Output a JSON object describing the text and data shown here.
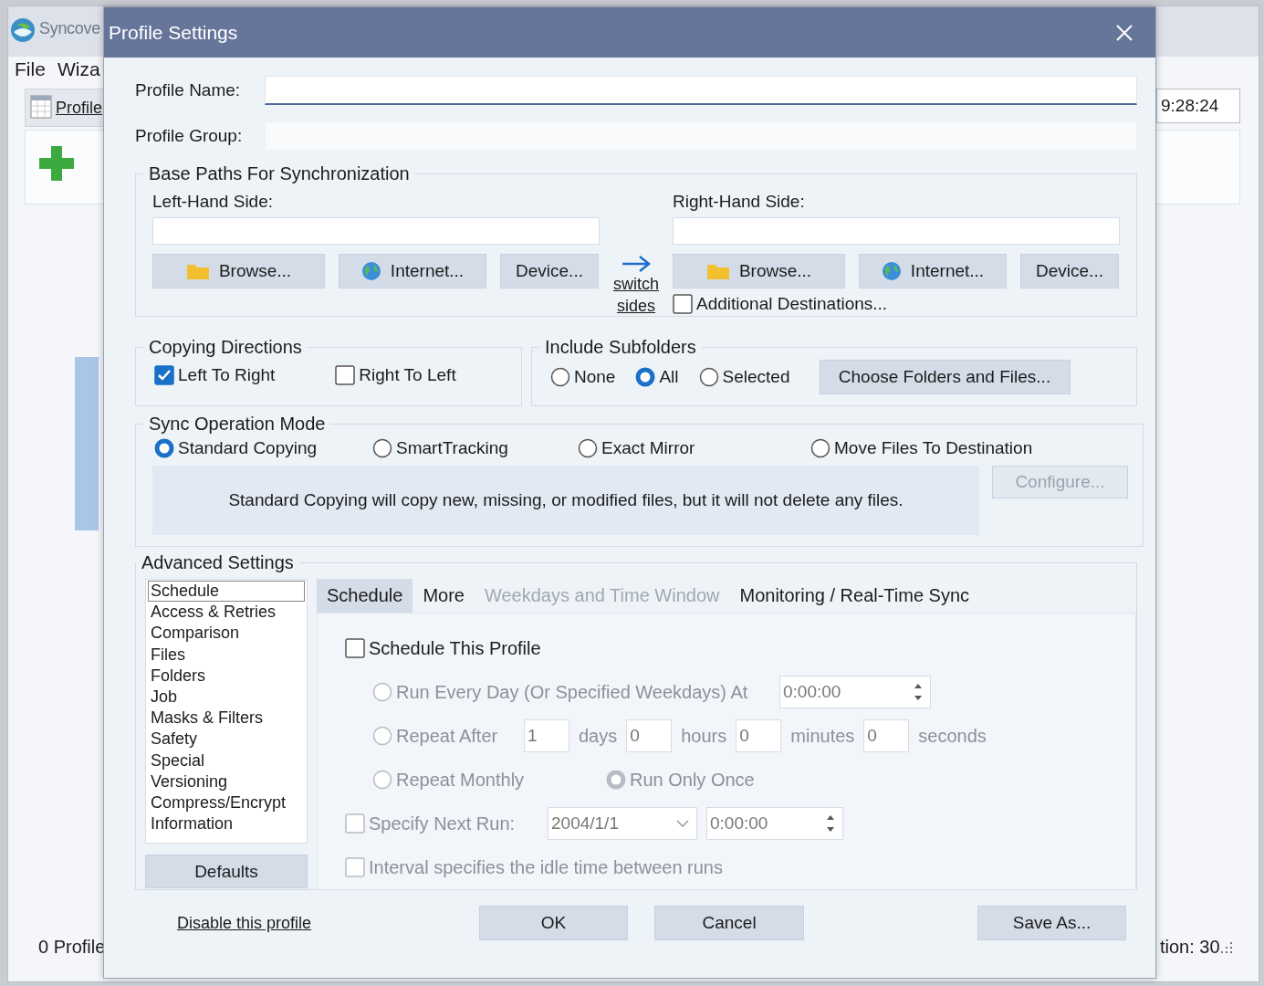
{
  "background_window": {
    "title": "Syncove",
    "menu": [
      "File",
      "Wiza"
    ],
    "tab": "Profile",
    "time": "9:28:24",
    "status_left": "0 Profile",
    "status_right": "tion: 30"
  },
  "dialog": {
    "title": "Profile Settings",
    "fields": [
      {
        "label": "Profile Name:",
        "focused": true
      },
      {
        "label": "Profile Group:",
        "focused": false
      }
    ],
    "base_paths": {
      "title": "Base Paths For Synchronization",
      "left": {
        "label": "Left-Hand Side:",
        "buttons": [
          {
            "label": "Browse...",
            "kind": "folder"
          },
          {
            "label": "Internet...",
            "kind": "globe"
          },
          {
            "label": "Device...",
            "kind": "plain"
          }
        ]
      },
      "switch": "switch sides",
      "right": {
        "label": "Right-Hand Side:",
        "buttons": [
          {
            "label": "Browse...",
            "kind": "folder"
          },
          {
            "label": "Internet...",
            "kind": "globe"
          },
          {
            "label": "Device...",
            "kind": "plain"
          }
        ]
      },
      "additional": {
        "label": "Additional Destinations...",
        "checked": false
      }
    },
    "copying_directions": {
      "title": "Copying Directions",
      "options": [
        {
          "label": "Left To Right",
          "checked": true
        },
        {
          "label": "Right To Left",
          "checked": false
        }
      ]
    },
    "include_subfolders": {
      "title": "Include Subfolders",
      "options": [
        {
          "label": "None",
          "selected": false
        },
        {
          "label": "All",
          "selected": true
        },
        {
          "label": "Selected",
          "selected": false
        }
      ],
      "button": "Choose Folders and Files..."
    },
    "sync_mode": {
      "title": "Sync Operation Mode",
      "options": [
        {
          "label": "Standard Copying",
          "selected": true
        },
        {
          "label": "SmartTracking",
          "selected": false
        },
        {
          "label": "Exact Mirror",
          "selected": false
        },
        {
          "label": "Move Files To Destination",
          "selected": false
        }
      ],
      "description": "Standard Copying will copy new, missing, or modified files, but it will not delete any files.",
      "configure": {
        "label": "Configure...",
        "disabled": true
      }
    },
    "advanced": {
      "title": "Advanced Settings",
      "list": [
        {
          "label": "Schedule",
          "selected": true
        },
        {
          "label": "Access & Retries",
          "selected": false
        },
        {
          "label": "Comparison",
          "selected": false
        },
        {
          "label": "Files",
          "selected": false
        },
        {
          "label": "Folders",
          "selected": false
        },
        {
          "label": "Job",
          "selected": false
        },
        {
          "label": "Masks & Filters",
          "selected": false
        },
        {
          "label": "Safety",
          "selected": false
        },
        {
          "label": "Special",
          "selected": false
        },
        {
          "label": "Versioning",
          "selected": false
        },
        {
          "label": "Compress/Encrypt",
          "selected": false
        },
        {
          "label": "Information",
          "selected": false
        }
      ],
      "defaults": "Defaults",
      "tabs": [
        {
          "label": "Schedule",
          "selected": true,
          "disabled": false
        },
        {
          "label": "More",
          "selected": false,
          "disabled": false
        },
        {
          "label": "Weekdays and Time Window",
          "selected": false,
          "disabled": true
        },
        {
          "label": "Monitoring / Real-Time Sync",
          "selected": false,
          "disabled": false
        }
      ],
      "schedule": [
        {
          "kind": "checkbox",
          "label": "Schedule This Profile",
          "checked": false,
          "disabled": false
        },
        {
          "kind": "radio-time",
          "label": "Run Every Day (Or Specified Weekdays) At",
          "selected": false,
          "value": "0:00:00",
          "disabled": true
        },
        {
          "kind": "repeat",
          "label": "Repeat After",
          "selected": false,
          "disabled": true,
          "fields": [
            {
              "value": "1",
              "unit": "days"
            },
            {
              "value": "0",
              "unit": "hours"
            },
            {
              "value": "0",
              "unit": "minutes"
            },
            {
              "value": "0",
              "unit": "seconds"
            }
          ]
        },
        {
          "kind": "radio-pair",
          "disabled": true,
          "options": [
            {
              "label": "Repeat Monthly",
              "selected": false
            },
            {
              "label": "Run Only Once",
              "selected": true
            }
          ]
        },
        {
          "kind": "next-run",
          "label": "Specify Next Run:",
          "checked": false,
          "disabled": true,
          "date": "2004/1/1",
          "time": "0:00:00"
        },
        {
          "kind": "checkbox",
          "label": "Interval specifies the idle time between runs",
          "checked": false,
          "disabled": true
        }
      ]
    },
    "footer": {
      "link": "Disable this profile",
      "buttons": [
        "OK",
        "Cancel",
        "Save As..."
      ]
    }
  }
}
